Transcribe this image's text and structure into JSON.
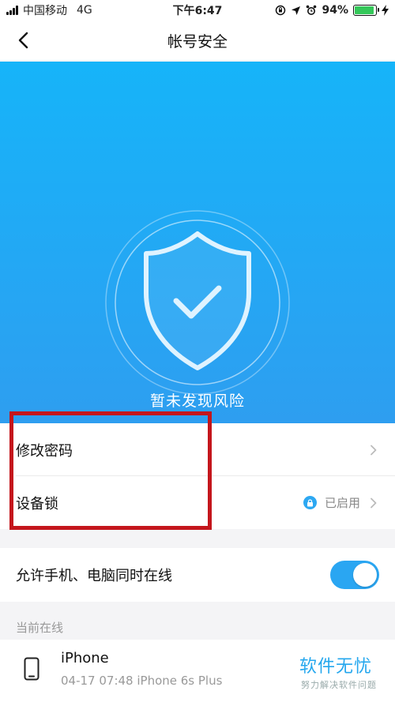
{
  "status": {
    "carrier": "中国移动",
    "network": "4G",
    "time": "下午6:47",
    "battery": "94%",
    "battery_level": 0.94,
    "battery_color": "#34c759"
  },
  "nav": {
    "title": "帐号安全",
    "back_icon": "chevron-left-icon"
  },
  "hero": {
    "status_text": "暂未发现风险",
    "icon": "shield-check-icon",
    "gradient_top": "#16b4f9",
    "gradient_bottom": "#2e9ef0"
  },
  "security_items": [
    {
      "label": "修改密码"
    },
    {
      "label": "设备锁",
      "status": "已启用",
      "status_icon": "lock-icon"
    }
  ],
  "online_setting": {
    "label": "允许手机、电脑同时在线",
    "enabled": true,
    "toggle_color": "#2aa6f2"
  },
  "current_online": {
    "section_label": "当前在线",
    "device_name": "iPhone",
    "device_detail": "04-17 07:48  iPhone 6s Plus"
  },
  "watermark": {
    "main": "软件无忧",
    "sub": "努力解决软件问题"
  },
  "annotation_color": "#c4161c"
}
